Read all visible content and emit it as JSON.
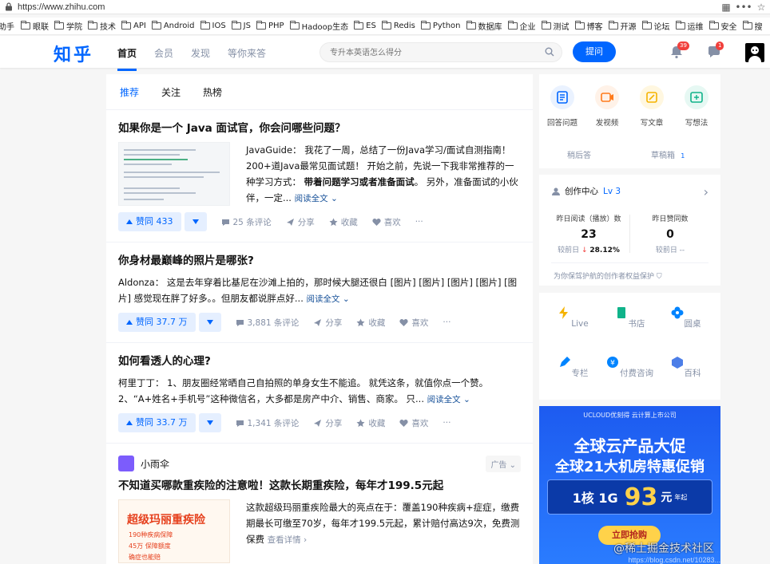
{
  "browser": {
    "url": "https://www.zhihu.com"
  },
  "bookmarks": {
    "lead": "助手",
    "items": [
      "眼联",
      "学院",
      "技术",
      "API",
      "Android",
      "IOS",
      "JS",
      "PHP",
      "Hadoop生态",
      "ES",
      "Redis",
      "Python",
      "数据库",
      "企业",
      "测试",
      "博客",
      "开源",
      "论坛",
      "运维",
      "安全",
      "搜"
    ]
  },
  "header": {
    "logo": "知乎",
    "nav": [
      "首页",
      "会员",
      "发现",
      "等你来答"
    ],
    "search_placeholder": "专升本英语怎么得分",
    "ask_label": "提问",
    "notify_count": "39",
    "msg_count": "1"
  },
  "feed": {
    "tabs": [
      "推荐",
      "关注",
      "热榜"
    ],
    "items": [
      {
        "title": "如果你是一个 Java 面试官，你会问哪些问题？",
        "excerpt_a": "JavaGuide： 我花了一周，总结了一份Java学习/面试自测指南！200+道Java最常见面试题！ 开始之前，先说一下我非常推荐的一种学习方式： ",
        "excerpt_bold": "带着问题学习或者准备面试",
        "excerpt_b": "。 另外，准备面试的小伙伴，一定...",
        "read_more": "阅读全文",
        "vote": "赞同 433",
        "comments": "25 条评论",
        "share": "分享",
        "fav": "收藏",
        "like": "喜欢"
      },
      {
        "title": "你身材最巅峰的照片是哪张?",
        "excerpt": "Aldonza： 这是去年穿着比基尼在沙滩上拍的，那时候大腿还很白 [图片] [图片] [图片] [图片] [图片] 感觉现在胖了好多。。但朋友都说胖点好...",
        "read_more": "阅读全文",
        "vote": "赞同 37.7 万",
        "comments": "3,881 条评论",
        "share": "分享",
        "fav": "收藏",
        "like": "喜欢"
      },
      {
        "title": "如何看透人的心理?",
        "excerpt": "柯里丁丁： 1、朋友圈经常晒自己自拍照的单身女生不能追。 就凭这条，就值你点一个赞。 2、“A+姓名+手机号”这种微信名，大多都是房产中介、销售、商家。 只...",
        "read_more": "阅读全文",
        "vote": "赞同 33.7 万",
        "comments": "1,341 条评论",
        "share": "分享",
        "fav": "收藏",
        "like": "喜欢"
      }
    ],
    "ad": {
      "brand": "小雨伞",
      "tag": "广告",
      "title": "不知道买哪款重疾险的注意啦！这款长期重疾险，每年才199.5元起",
      "excerpt": "这款超级玛丽重疾险最大的亮点在于：覆盖190种疾病+症症，缴费期最长可缴至70岁，每年才199.5元起，累计赔付高达9次，免费测保费",
      "detail": "查看详情",
      "img_title": "超级玛丽重疾险",
      "img_lines": [
        "190种疾病保障",
        "45万 保障额度",
        "确症也能赔"
      ]
    }
  },
  "sidebar": {
    "create": {
      "items": [
        "回答问题",
        "发视频",
        "写文章",
        "写想法"
      ],
      "later": "稍后答",
      "drafts": "草稿箱",
      "drafts_count": "1"
    },
    "center": {
      "title": "创作中心",
      "level": "Lv 3",
      "stat1_label": "昨日阅读（播放）数",
      "stat1_value": "23",
      "stat1_cmp": "较前日",
      "stat1_delta": "28.12%",
      "stat2_label": "昨日赞同数",
      "stat2_value": "0",
      "stat2_cmp": "较前日 --",
      "footer": "为你保驾护航的创作者权益保护"
    },
    "grid": [
      "Live",
      "书店",
      "圆桌",
      "专栏",
      "付费咨询",
      "百科"
    ]
  },
  "banner": {
    "top": "UCLOUD优刻得 云计算上市公司",
    "line1": "全球云产品大促",
    "line2": "全球21大机房特惠促销",
    "price_prefix": "1核 1G",
    "price": "93",
    "price_unit": "元",
    "price_suffix": "年起",
    "cta": "立即抢购",
    "watermark": "@稀土掘金技术社区",
    "watermark_url": "https://blog.csdn.net/10283..."
  },
  "colors": {
    "brand": "#0066ff",
    "badge": "#f1403c"
  }
}
